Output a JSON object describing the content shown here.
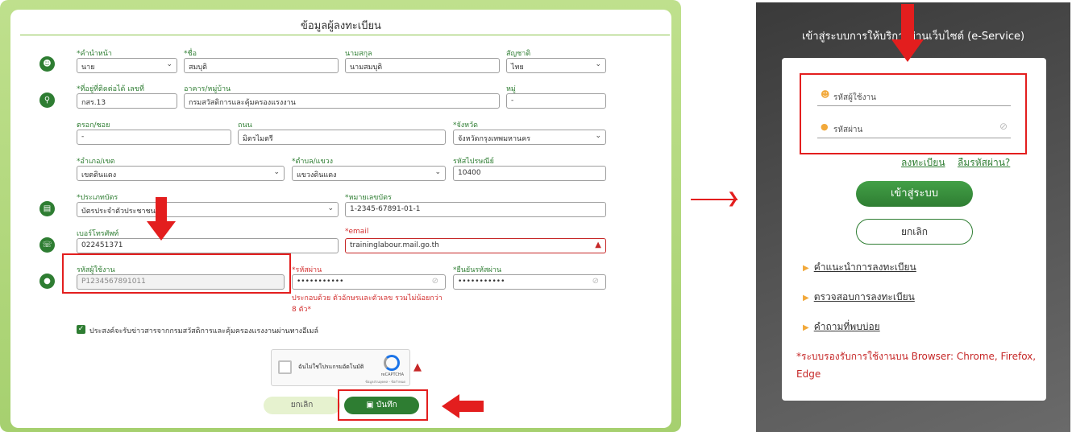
{
  "form": {
    "title": "ข้อมูลผู้ลงทะเบียน",
    "fields": {
      "prefix": {
        "label": "*คำนำหน้า",
        "value": "นาย"
      },
      "first_name": {
        "label": "*ชื่อ",
        "value": "สมบุติ"
      },
      "last_name": {
        "label": "นามสกุล",
        "value": "นามสมบุติ"
      },
      "nationality": {
        "label": "สัญชาติ",
        "value": "ไทย"
      },
      "address_no": {
        "label": "*ที่อยู่ที่ติดต่อได้ เลขที่",
        "value": "กสร.13"
      },
      "building": {
        "label": "อาคาร/หมู่บ้าน",
        "value": "กรมสวัสดิการและคุ้มครองแรงงาน"
      },
      "moo": {
        "label": "หมู่",
        "value": "-"
      },
      "soi": {
        "label": "ตรอก/ซอย",
        "value": "-"
      },
      "road": {
        "label": "ถนน",
        "value": "มิตรไมตรี"
      },
      "province": {
        "label": "*จังหวัด",
        "value": "จังหวัดกรุงเทพมหานคร"
      },
      "district": {
        "label": "*อำเภอ/เขต",
        "value": "เขตดินแดง"
      },
      "subdistrict": {
        "label": "*ตำบล/แขวง",
        "value": "แขวงดินแดง"
      },
      "postcode": {
        "label": "รหัสไปรษณีย์",
        "value": "10400"
      },
      "card_type": {
        "label": "*ประเภทบัตร",
        "value": "บัตรประจำตัวประชาชน"
      },
      "card_no": {
        "label": "*หมายเลขบัตร",
        "value": "1-2345-67891-01-1"
      },
      "phone": {
        "label": "เบอร์โทรศัพท์",
        "value": "022451371"
      },
      "email": {
        "label": "*email",
        "value": "traininglabour.mail.go.th"
      },
      "username": {
        "label": "รหัสผู้ใช้งาน",
        "value": "P1234567891011"
      },
      "password": {
        "label": "*รหัสผ่าน",
        "value": "•••••••••••"
      },
      "confirm_password": {
        "label": "*ยืนยันรหัสผ่าน",
        "value": "•••••••••••"
      }
    },
    "password_hint": "ประกอบด้วย ตัวอักษรและตัวเลข รวมไม่น้อยกว่า 8 ตัว*",
    "consent_label": "ประสงค์จะรับข่าวสารจากกรมสวัสดิการและคุ้มครองแรงงานผ่านทางอีเมล์",
    "captcha": {
      "label": "ฉันไม่ใช่โปรแกรมอัตโนมัติ",
      "brand": "reCAPTCHA",
      "terms": "ข้อมูลส่วนบุคคล - ข้อกำหนด"
    },
    "cancel_label": "ยกเลิก",
    "save_label": "บันทึก"
  },
  "login": {
    "title": "เข้าสู่ระบบการให้บริการผ่านเว็บไซต์ (e-Service)",
    "username_placeholder": "รหัสผู้ใช้งาน",
    "password_placeholder": "รหัสผ่าน",
    "register_link": "ลงทะเบียน",
    "forgot_link": "ลืมรหัสผ่าน?",
    "login_button": "เข้าสู่ระบบ",
    "cancel_button": "ยกเลิก",
    "help_items": [
      "คำแนะนำการลงทะเบียน",
      "ตรวจสอบการลงทะเบียน",
      "คำถามที่พบบ่อย"
    ],
    "browser_note": "*ระบบรองรับการใช้งานบน Browser: Chrome, Firefox, Edge"
  },
  "colors": {
    "accent": "#2e7d32",
    "highlight": "#e31e1e",
    "warning": "#d32f2f"
  },
  "icons": [
    "user-icon",
    "location-pin-icon",
    "id-card-icon",
    "phone-icon",
    "lock-icon",
    "eye-off-icon",
    "chevron-down-icon",
    "warning-icon",
    "save-icon",
    "arrow-right-icon"
  ]
}
